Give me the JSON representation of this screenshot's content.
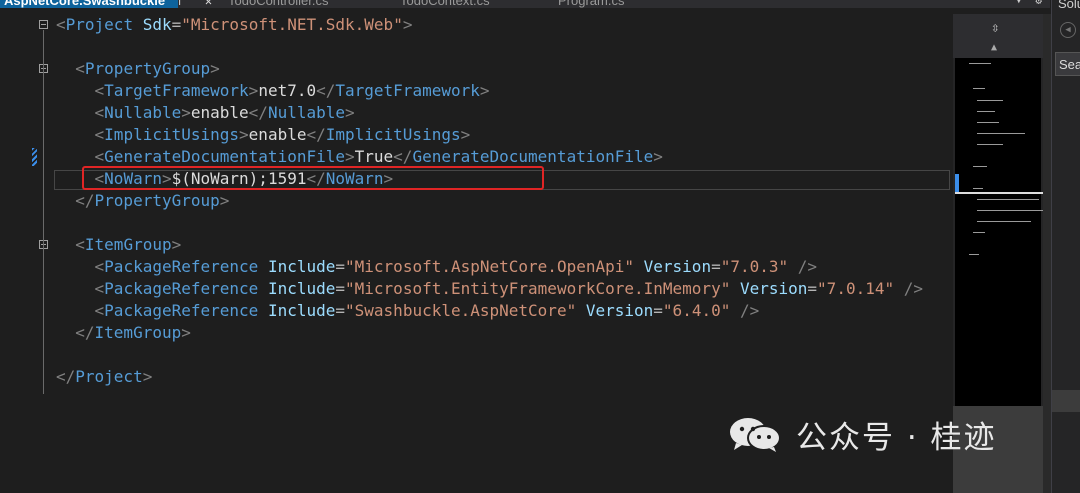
{
  "tabs": [
    {
      "label": "AspNetCore.Swashbuckle",
      "active": true
    },
    {
      "label": "TodoController.cs",
      "active": false
    },
    {
      "label": "TodoContext.cs",
      "active": false
    },
    {
      "label": "Program.cs",
      "active": false
    }
  ],
  "tab_icons": {
    "pin": "⊤",
    "close": "✕"
  },
  "side_panel": {
    "title": "Solu",
    "search": "Sea"
  },
  "code_lines": [
    [
      {
        "c": "b",
        "t": "<"
      },
      {
        "c": "t",
        "t": "Project"
      },
      {
        "c": "x",
        "t": " "
      },
      {
        "c": "a",
        "t": "Sdk"
      },
      {
        "c": "eq",
        "t": "="
      },
      {
        "c": "s",
        "t": "\"Microsoft.NET.Sdk.Web\""
      },
      {
        "c": "b",
        "t": ">"
      }
    ],
    [],
    [
      {
        "c": "x",
        "t": "  "
      },
      {
        "c": "b",
        "t": "<"
      },
      {
        "c": "t",
        "t": "PropertyGroup"
      },
      {
        "c": "b",
        "t": ">"
      }
    ],
    [
      {
        "c": "x",
        "t": "    "
      },
      {
        "c": "b",
        "t": "<"
      },
      {
        "c": "t",
        "t": "TargetFramework"
      },
      {
        "c": "b",
        "t": ">"
      },
      {
        "c": "x",
        "t": "net7.0"
      },
      {
        "c": "b",
        "t": "</"
      },
      {
        "c": "t",
        "t": "TargetFramework"
      },
      {
        "c": "b",
        "t": ">"
      }
    ],
    [
      {
        "c": "x",
        "t": "    "
      },
      {
        "c": "b",
        "t": "<"
      },
      {
        "c": "t",
        "t": "Nullable"
      },
      {
        "c": "b",
        "t": ">"
      },
      {
        "c": "x",
        "t": "enable"
      },
      {
        "c": "b",
        "t": "</"
      },
      {
        "c": "t",
        "t": "Nullable"
      },
      {
        "c": "b",
        "t": ">"
      }
    ],
    [
      {
        "c": "x",
        "t": "    "
      },
      {
        "c": "b",
        "t": "<"
      },
      {
        "c": "t",
        "t": "ImplicitUsings"
      },
      {
        "c": "b",
        "t": ">"
      },
      {
        "c": "x",
        "t": "enable"
      },
      {
        "c": "b",
        "t": "</"
      },
      {
        "c": "t",
        "t": "ImplicitUsings"
      },
      {
        "c": "b",
        "t": ">"
      }
    ],
    [
      {
        "c": "x",
        "t": "    "
      },
      {
        "c": "b",
        "t": "<"
      },
      {
        "c": "t",
        "t": "GenerateDocumentationFile"
      },
      {
        "c": "b",
        "t": ">"
      },
      {
        "c": "x",
        "t": "True"
      },
      {
        "c": "b",
        "t": "</"
      },
      {
        "c": "t",
        "t": "GenerateDocumentationFile"
      },
      {
        "c": "b",
        "t": ">"
      }
    ],
    [
      {
        "c": "x",
        "t": "    "
      },
      {
        "c": "b",
        "t": "<"
      },
      {
        "c": "t",
        "t": "NoWarn"
      },
      {
        "c": "b",
        "t": ">"
      },
      {
        "c": "x",
        "t": "$(NoWarn);1591"
      },
      {
        "c": "b",
        "t": "</"
      },
      {
        "c": "t",
        "t": "NoWarn"
      },
      {
        "c": "b",
        "t": ">"
      }
    ],
    [
      {
        "c": "x",
        "t": "  "
      },
      {
        "c": "b",
        "t": "</"
      },
      {
        "c": "t",
        "t": "PropertyGroup"
      },
      {
        "c": "b",
        "t": ">"
      }
    ],
    [],
    [
      {
        "c": "x",
        "t": "  "
      },
      {
        "c": "b",
        "t": "<"
      },
      {
        "c": "t",
        "t": "ItemGroup"
      },
      {
        "c": "b",
        "t": ">"
      }
    ],
    [
      {
        "c": "x",
        "t": "    "
      },
      {
        "c": "b",
        "t": "<"
      },
      {
        "c": "t",
        "t": "PackageReference"
      },
      {
        "c": "x",
        "t": " "
      },
      {
        "c": "a",
        "t": "Include"
      },
      {
        "c": "eq",
        "t": "="
      },
      {
        "c": "s",
        "t": "\"Microsoft.AspNetCore.OpenApi\""
      },
      {
        "c": "x",
        "t": " "
      },
      {
        "c": "a",
        "t": "Version"
      },
      {
        "c": "eq",
        "t": "="
      },
      {
        "c": "s",
        "t": "\"7.0.3\""
      },
      {
        "c": "x",
        "t": " "
      },
      {
        "c": "b",
        "t": "/>"
      }
    ],
    [
      {
        "c": "x",
        "t": "    "
      },
      {
        "c": "b",
        "t": "<"
      },
      {
        "c": "t",
        "t": "PackageReference"
      },
      {
        "c": "x",
        "t": " "
      },
      {
        "c": "a",
        "t": "Include"
      },
      {
        "c": "eq",
        "t": "="
      },
      {
        "c": "s",
        "t": "\"Microsoft.EntityFrameworkCore.InMemory\""
      },
      {
        "c": "x",
        "t": " "
      },
      {
        "c": "a",
        "t": "Version"
      },
      {
        "c": "eq",
        "t": "="
      },
      {
        "c": "s",
        "t": "\"7.0.14\""
      },
      {
        "c": "x",
        "t": " "
      },
      {
        "c": "b",
        "t": "/>"
      }
    ],
    [
      {
        "c": "x",
        "t": "    "
      },
      {
        "c": "b",
        "t": "<"
      },
      {
        "c": "t",
        "t": "PackageReference"
      },
      {
        "c": "x",
        "t": " "
      },
      {
        "c": "a",
        "t": "Include"
      },
      {
        "c": "eq",
        "t": "="
      },
      {
        "c": "s",
        "t": "\"Swashbuckle.AspNetCore\""
      },
      {
        "c": "x",
        "t": " "
      },
      {
        "c": "a",
        "t": "Version"
      },
      {
        "c": "eq",
        "t": "="
      },
      {
        "c": "s",
        "t": "\"6.4.0\""
      },
      {
        "c": "x",
        "t": " "
      },
      {
        "c": "b",
        "t": "/>"
      }
    ],
    [
      {
        "c": "x",
        "t": "  "
      },
      {
        "c": "b",
        "t": "</"
      },
      {
        "c": "t",
        "t": "ItemGroup"
      },
      {
        "c": "b",
        "t": ">"
      }
    ],
    [],
    [
      {
        "c": "b",
        "t": "</"
      },
      {
        "c": "t",
        "t": "Project"
      },
      {
        "c": "b",
        "t": ">"
      }
    ]
  ],
  "watermark": {
    "text": "公众号 · 桂迹",
    "icon": "wechat-icon"
  },
  "colors": {
    "tag": "#569cd6",
    "attr": "#9cdcfe",
    "string": "#ce9178",
    "highlight": "#e02525",
    "accent": "#0e639c"
  }
}
